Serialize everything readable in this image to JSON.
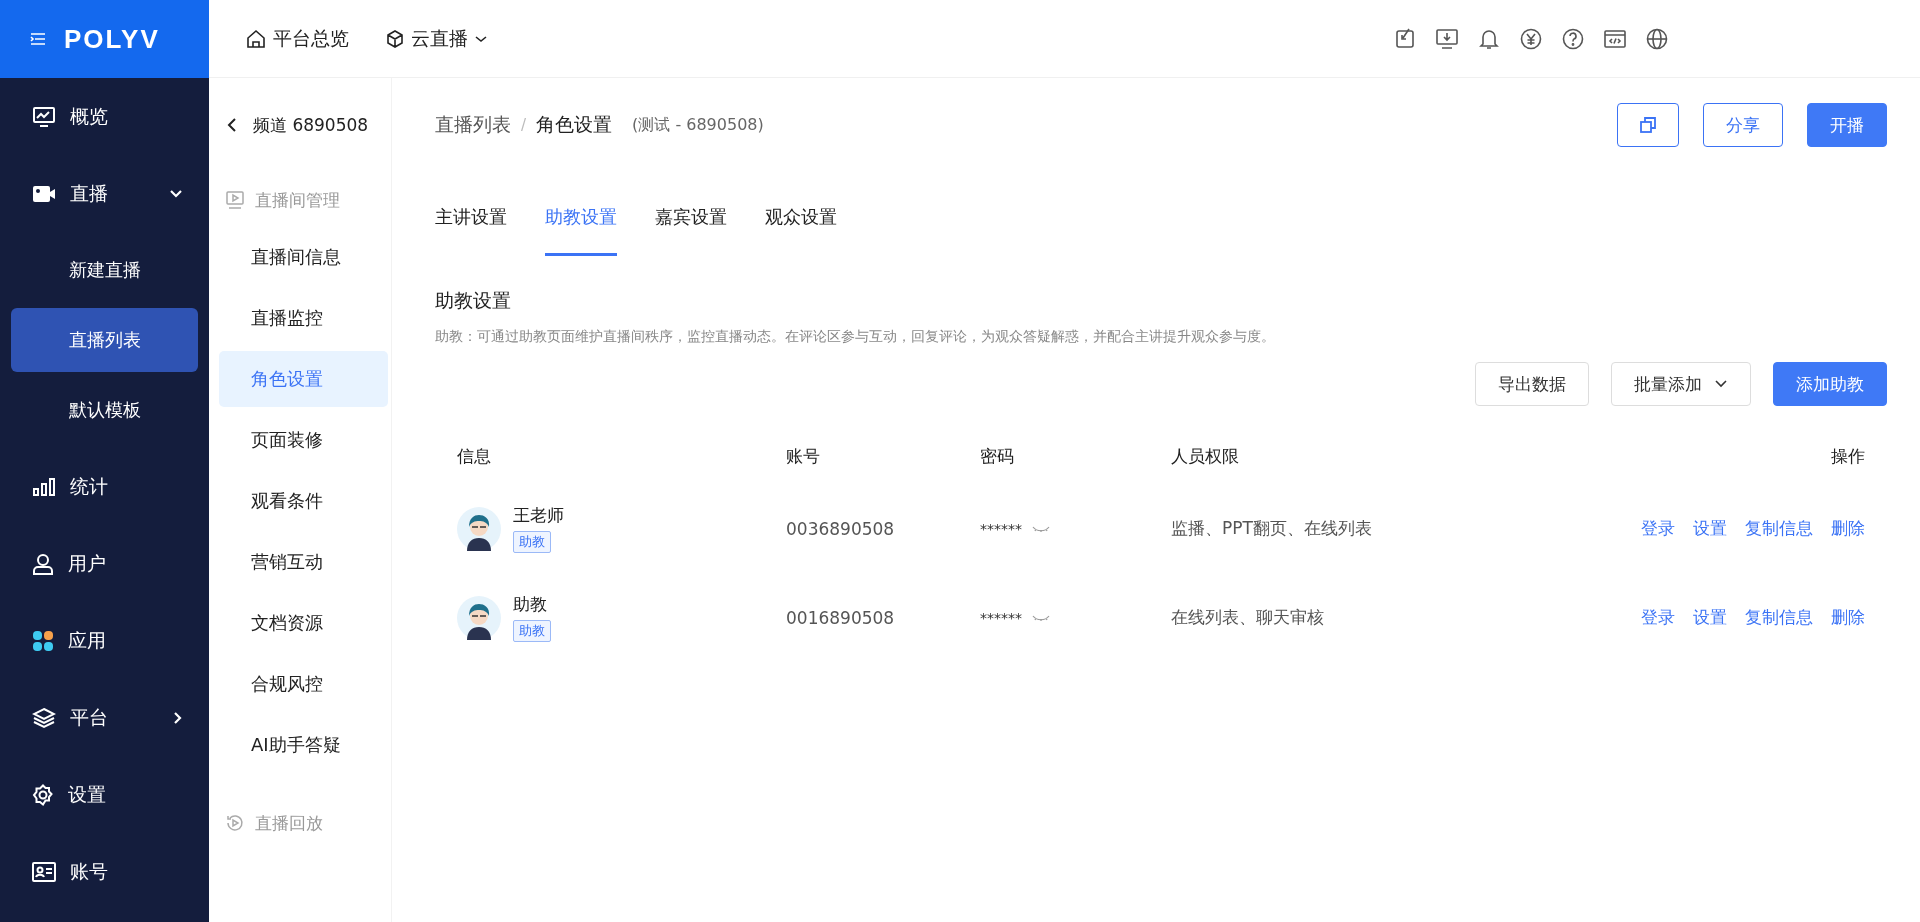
{
  "header": {
    "logo": "POLYV",
    "nav": [
      {
        "label": "平台总览",
        "has_caret": false
      },
      {
        "label": "云直播",
        "has_caret": true
      }
    ]
  },
  "sidebar": {
    "items": [
      {
        "label": "概览",
        "selected": false
      },
      {
        "label": "直播",
        "selected": false,
        "expanded": true,
        "children": [
          {
            "label": "新建直播",
            "selected": false
          },
          {
            "label": "直播列表",
            "selected": true
          },
          {
            "label": "默认模板",
            "selected": false
          }
        ]
      },
      {
        "label": "统计",
        "selected": false
      },
      {
        "label": "用户",
        "selected": false
      },
      {
        "label": "应用",
        "selected": false
      },
      {
        "label": "平台",
        "selected": false,
        "expanded": false
      },
      {
        "label": "设置",
        "selected": false
      },
      {
        "label": "账号",
        "selected": false
      }
    ]
  },
  "subnav": {
    "back": "频道 6890508",
    "groups": [
      {
        "title": "直播间管理",
        "items": [
          {
            "label": "直播间信息",
            "selected": false
          },
          {
            "label": "直播监控",
            "selected": false
          },
          {
            "label": "角色设置",
            "selected": true
          },
          {
            "label": "页面装修",
            "selected": false
          },
          {
            "label": "观看条件",
            "selected": false
          },
          {
            "label": "营销互动",
            "selected": false
          },
          {
            "label": "文档资源",
            "selected": false
          },
          {
            "label": "合规风控",
            "selected": false
          },
          {
            "label": "AI助手答疑",
            "selected": false
          }
        ]
      },
      {
        "title": "直播回放"
      }
    ]
  },
  "page": {
    "breadcrumb": [
      "直播列表",
      "角色设置"
    ],
    "breadcrumb_separator": "/",
    "subtitle": "(测试 - 6890508)",
    "actions": [
      {
        "kind": "icon"
      },
      {
        "kind": "outline",
        "label": "分享"
      },
      {
        "kind": "primary",
        "label": "开播"
      }
    ],
    "tabs": [
      {
        "label": "主讲设置",
        "selected": false
      },
      {
        "label": "助教设置",
        "selected": true
      },
      {
        "label": "嘉宾设置",
        "selected": false
      },
      {
        "label": "观众设置",
        "selected": false
      }
    ],
    "section": {
      "title": "助教设置",
      "description": "助教：可通过助教页面维护直播间秩序，监控直播动态。在评论区参与互动，回复评论，为观众答疑解惑，并配合主讲提升观众参与度。"
    },
    "toolbar": [
      {
        "kind": "default",
        "label": "导出数据"
      },
      {
        "kind": "dropdown",
        "label": "批量添加"
      },
      {
        "kind": "primary",
        "label": "添加助教"
      }
    ],
    "table": {
      "columns": [
        "信息",
        "账号",
        "密码",
        "人员权限",
        "操作"
      ],
      "rows": [
        {
          "name": "王老师",
          "tag": "助教",
          "account": "0036890508",
          "password": "******",
          "permissions": "监播、PPT翻页、在线列表",
          "actions": [
            "登录",
            "设置",
            "复制信息",
            "删除"
          ]
        },
        {
          "name": "助教",
          "tag": "助教",
          "account": "0016890508",
          "password": "******",
          "permissions": "在线列表、聊天审核",
          "actions": [
            "登录",
            "设置",
            "复制信息",
            "删除"
          ]
        }
      ]
    }
  }
}
